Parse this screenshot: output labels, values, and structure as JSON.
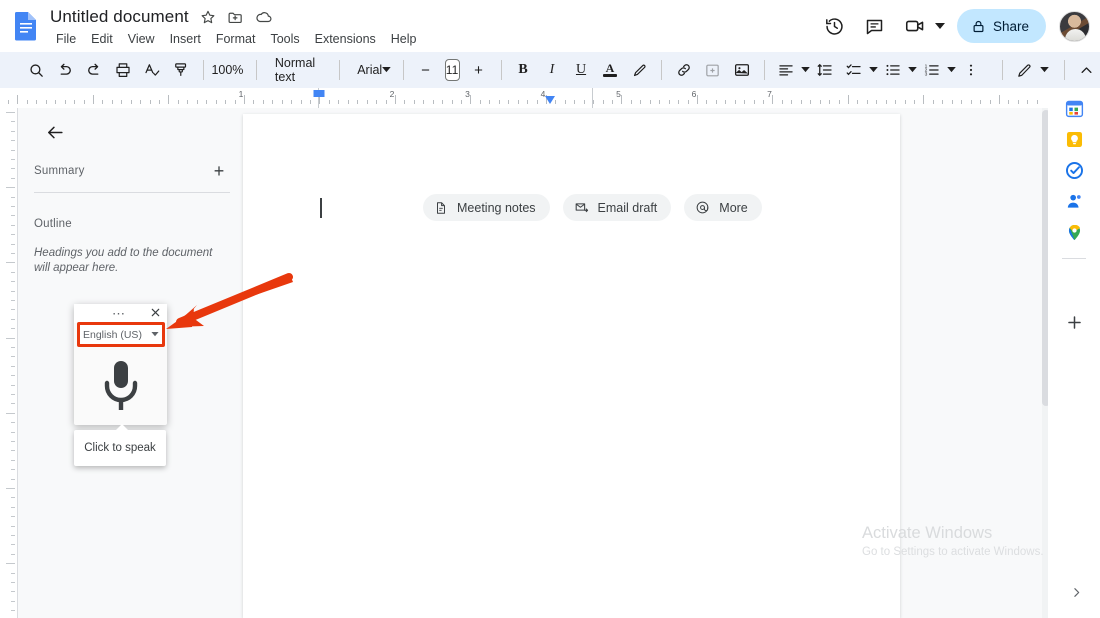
{
  "app": {
    "name": "Google Docs",
    "document_title": "Untitled document",
    "title_icons": [
      "star-icon",
      "move-to-folder-icon",
      "cloud-saved-icon"
    ],
    "menus": [
      "File",
      "Edit",
      "View",
      "Insert",
      "Format",
      "Tools",
      "Extensions",
      "Help"
    ]
  },
  "topright": {
    "history_icon": "version-history-icon",
    "comments_icon": "comment-icon",
    "meet_icon": "video-camera-icon",
    "meet_caret": "chevron-down-icon",
    "share_label": "Share",
    "share_icon": "lock-icon",
    "share_bg": "#c2e7ff",
    "avatar": "account-avatar"
  },
  "toolbar": {
    "search_icon": "search-icon",
    "undo_icon": "undo-icon",
    "redo_icon": "redo-icon",
    "print_icon": "print-icon",
    "spellcheck_icon": "spellcheck-icon",
    "paint_format_icon": "paint-format-icon",
    "zoom_value": "100%",
    "style_value": "Normal text",
    "font_value": "Arial",
    "font_size_decrease": "−",
    "font_size_value": "11",
    "font_size_increase": "+",
    "bold_label": "B",
    "italic_label": "I",
    "underline_label": "U",
    "text_color_label": "A",
    "highlight_icon": "highlight-pen-icon",
    "link_icon": "insert-link-icon",
    "comment_icon": "add-comment-icon",
    "image_icon": "insert-image-icon",
    "align_icon": "align-left-icon",
    "line_spacing_icon": "line-spacing-icon",
    "checklist_icon": "checklist-icon",
    "bulleted_list_icon": "bulleted-list-icon",
    "numbered_list_icon": "numbered-list-icon",
    "more_icon": "more-options-icon",
    "editing_mode_icon": "pencil-editing-icon",
    "collapse_icon": "chevron-up-icon"
  },
  "ruler": {
    "numbers": [
      "1",
      "1",
      "2",
      "3",
      "4",
      "5",
      "6",
      "7"
    ],
    "indent_marker_color": "#4285f4"
  },
  "sidebar": {
    "back_icon": "arrow-back-icon",
    "summary_label": "Summary",
    "add_summary_icon": "plus-icon",
    "outline_label": "Outline",
    "outline_hint": "Headings you add to the document will appear here."
  },
  "document": {
    "chips": [
      {
        "label": "Meeting notes",
        "icon": "document-icon"
      },
      {
        "label": "Email draft",
        "icon": "email-icon"
      },
      {
        "label": "More",
        "icon": "at-sign-icon"
      }
    ]
  },
  "voice_panel": {
    "more_label": "⋯",
    "more_icon": "more-options-icon",
    "close_icon": "close-icon",
    "language_value": "English (US)",
    "language_caret": "chevron-down-icon",
    "mic_icon": "microphone-icon",
    "tooltip_label": "Click to speak",
    "highlight_color": "#e8380d"
  },
  "annotation": {
    "arrow_color": "#e8380d",
    "arrow_points_to": "language-dropdown"
  },
  "right_rail": {
    "items": [
      {
        "name": "calendar-icon"
      },
      {
        "name": "keep-icon"
      },
      {
        "name": "tasks-icon"
      },
      {
        "name": "contacts-icon"
      },
      {
        "name": "maps-icon"
      }
    ],
    "add_icon": "plus-icon",
    "expand_icon": "chevron-right-icon"
  },
  "watermark": {
    "line1": "Activate Windows",
    "line2": "Go to Settings to activate Windows."
  }
}
